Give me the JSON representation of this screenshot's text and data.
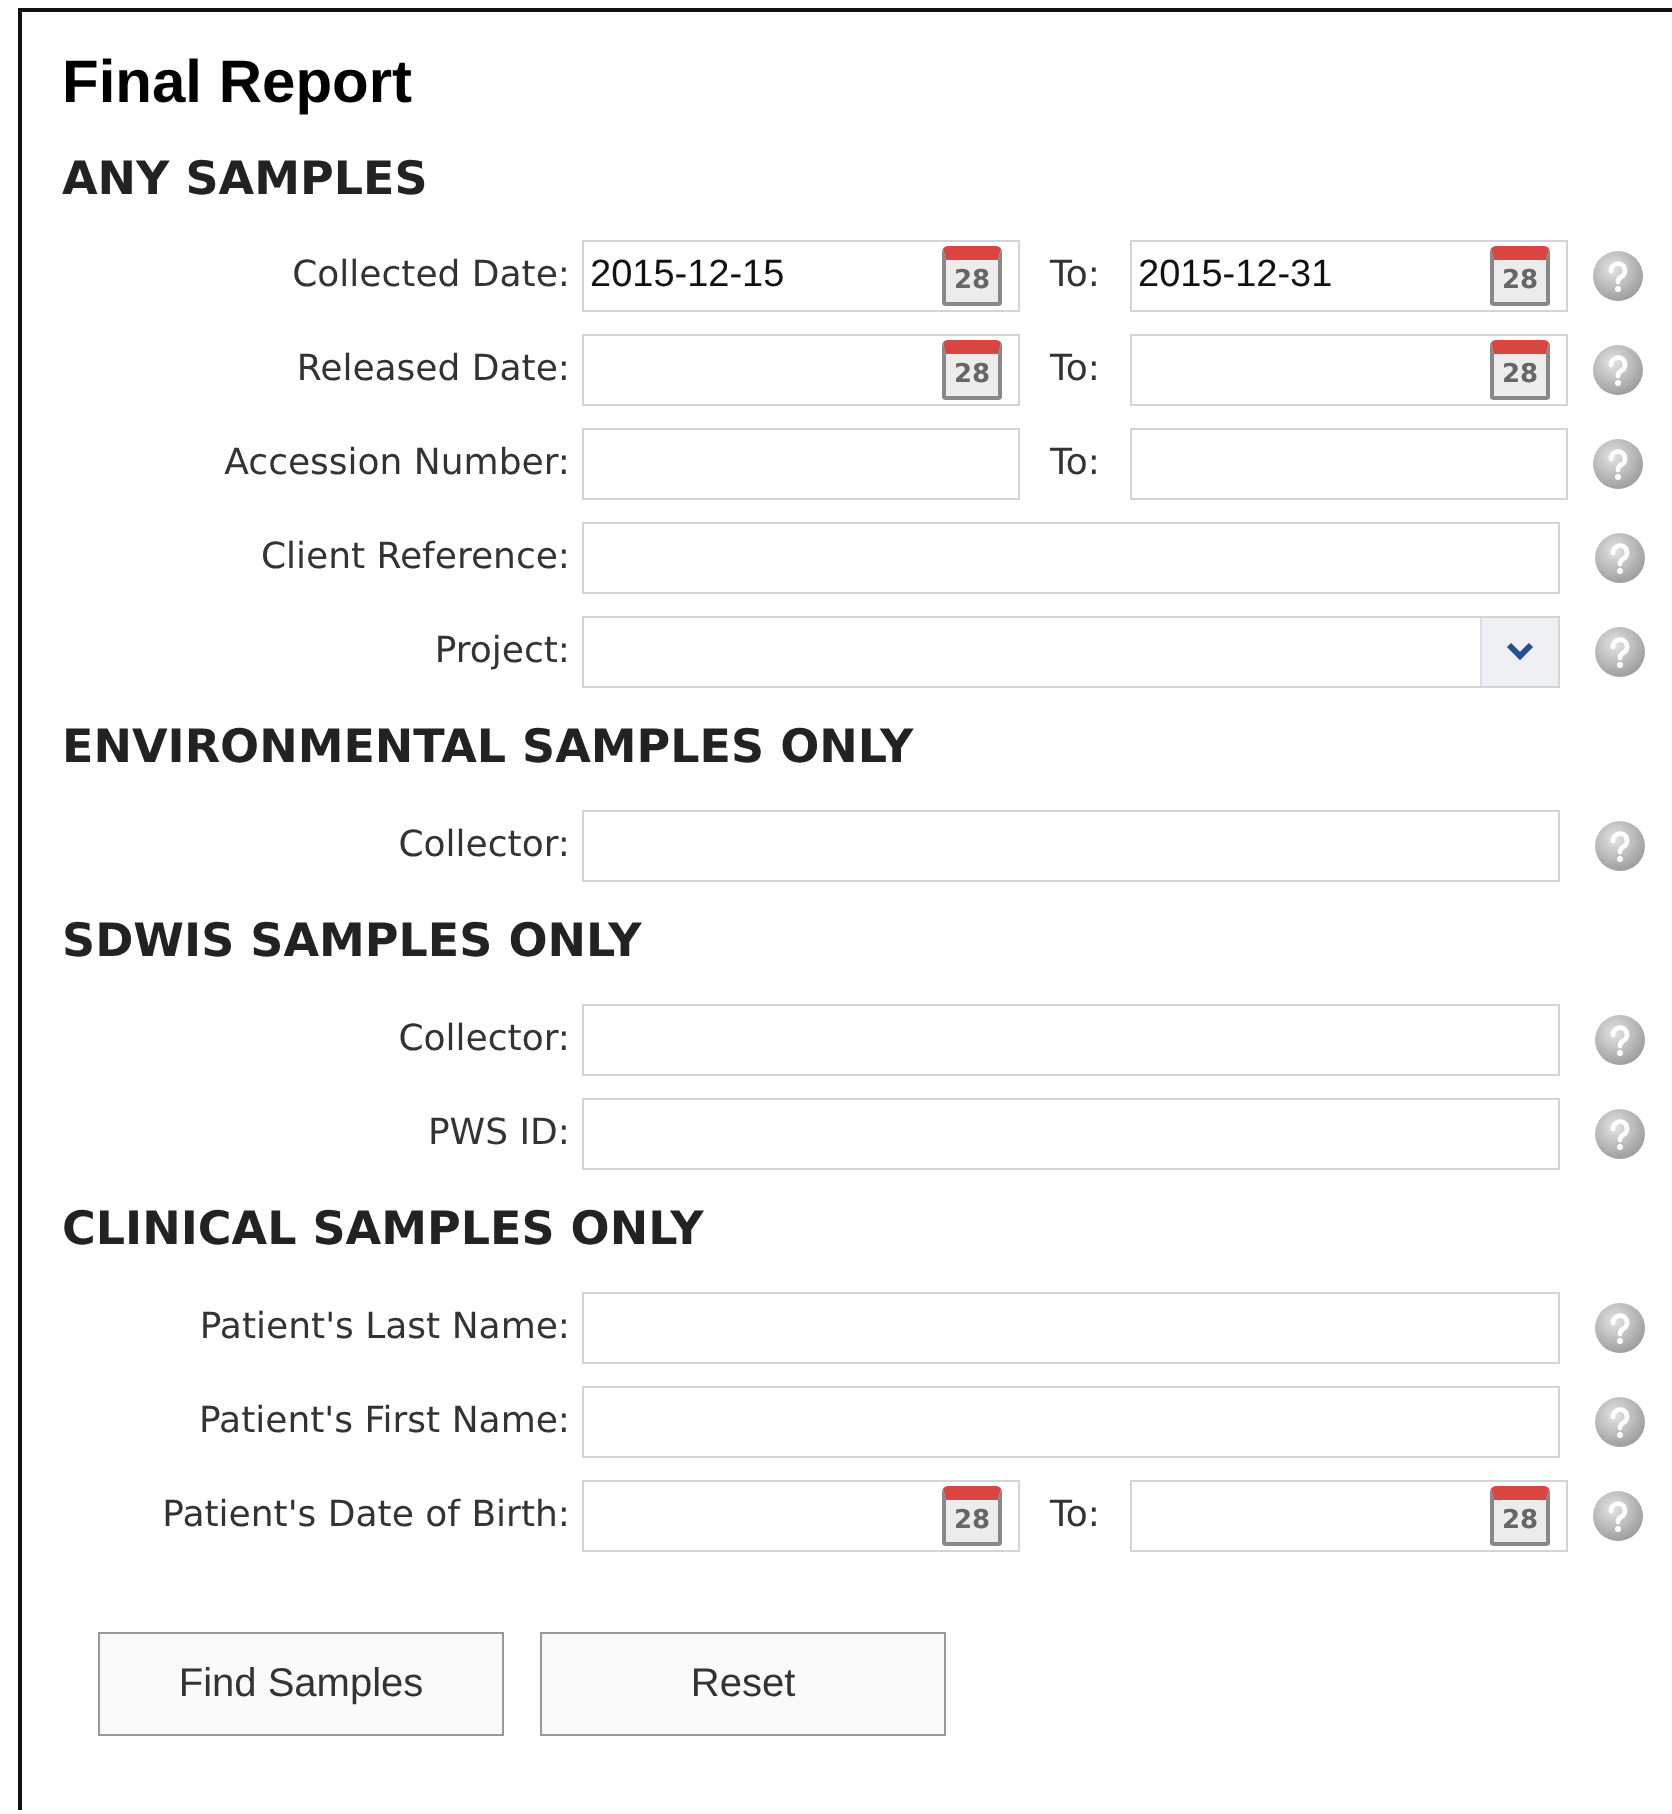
{
  "title": "Final Report",
  "sections": [
    {
      "heading": "ANY SAMPLES",
      "rows": [
        {
          "kind": "date_range",
          "label": "Collected Date:",
          "from": {
            "value": "2015-12-15",
            "calendar_day": "28"
          },
          "to_label": "To:",
          "to": {
            "value": "2015-12-31",
            "calendar_day": "28"
          }
        },
        {
          "kind": "date_range",
          "label": "Released Date:",
          "from": {
            "calendar_day": "28"
          },
          "to_label": "To:",
          "to": {
            "calendar_day": "28"
          }
        },
        {
          "kind": "text_range",
          "label": "Accession Number:",
          "to_label": "To:"
        },
        {
          "kind": "text",
          "label": "Client Reference:"
        },
        {
          "kind": "select",
          "label": "Project:"
        }
      ]
    },
    {
      "heading": "ENVIRONMENTAL SAMPLES ONLY",
      "rows": [
        {
          "kind": "text",
          "label": "Collector:"
        }
      ]
    },
    {
      "heading": "SDWIS SAMPLES ONLY",
      "rows": [
        {
          "kind": "text",
          "label": "Collector:"
        },
        {
          "kind": "text",
          "label": "PWS ID:"
        }
      ]
    },
    {
      "heading": "CLINICAL SAMPLES ONLY",
      "rows": [
        {
          "kind": "text",
          "label": "Patient's Last Name:"
        },
        {
          "kind": "text",
          "label": "Patient's First Name:"
        },
        {
          "kind": "date_range",
          "label": "Patient's Date of Birth:",
          "from": {
            "calendar_day": "28"
          },
          "to_label": "To:",
          "to": {
            "calendar_day": "28"
          }
        }
      ]
    }
  ],
  "buttons": [
    "Find Samples",
    "Reset"
  ]
}
